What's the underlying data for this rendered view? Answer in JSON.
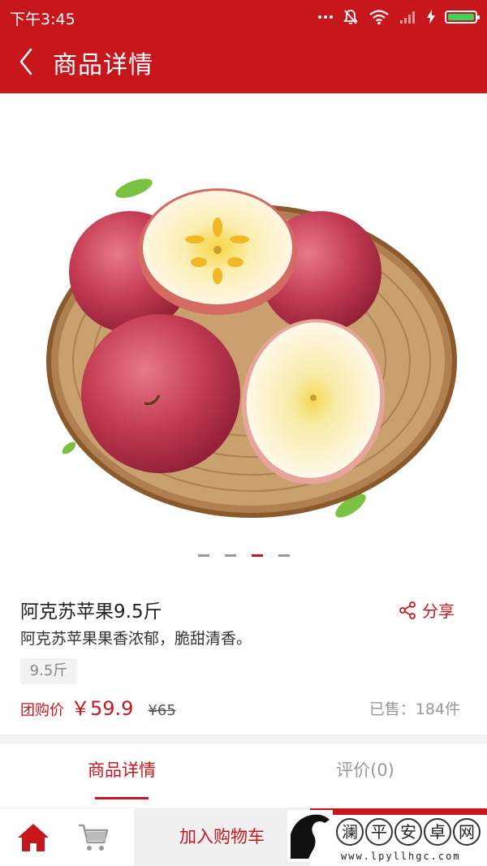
{
  "status_bar": {
    "time": "下午3:45"
  },
  "header": {
    "title": "商品详情",
    "back_icon": "chevron-left-icon"
  },
  "carousel": {
    "image_subject": "apples-in-bamboo-basket",
    "slide_count": 4,
    "active_index": 2
  },
  "product": {
    "name": "阿克苏苹果9.5斤",
    "description": "阿克苏苹果果香浓郁，脆甜清香。",
    "spec": "9.5斤",
    "price_label": "团购价",
    "price": "￥59.9",
    "original_price": "¥65",
    "sold": "已售：184件",
    "share_label": "分享"
  },
  "tabs": [
    {
      "label": "商品详情",
      "active": true
    },
    {
      "label": "评价(0)",
      "active": false
    }
  ],
  "bottom_bar": {
    "add_to_cart_label": "加入购物车",
    "home_icon": "home-icon",
    "cart_icon": "cart-icon"
  },
  "watermark": {
    "chars": [
      "澜",
      "平",
      "安",
      "卓",
      "网"
    ],
    "url": "www.lpyllhgc.com"
  },
  "colors": {
    "brand_red": "#c8161d",
    "battery_green": "#3cd35a"
  }
}
